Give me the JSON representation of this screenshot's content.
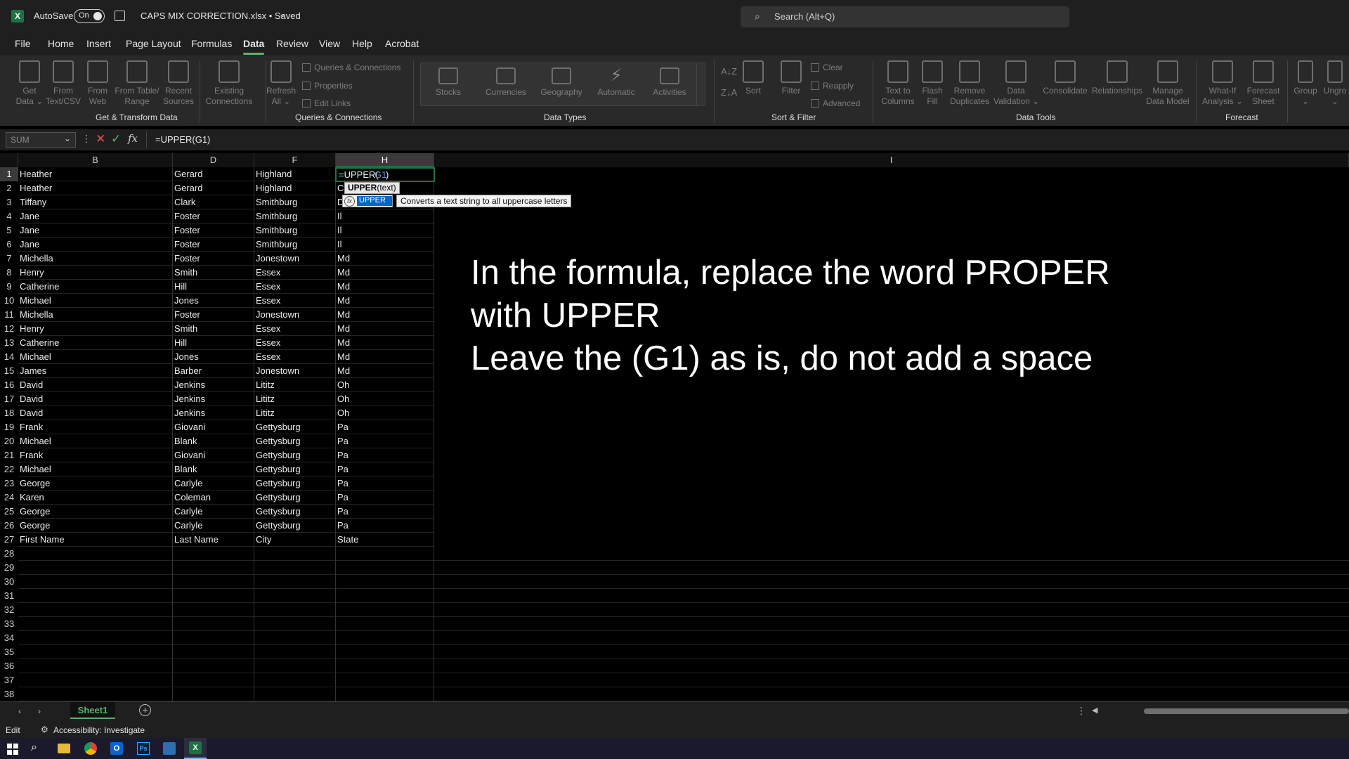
{
  "title": {
    "autosave_label": "AutoSave",
    "autosave_state": "On",
    "filename": "CAPS MIX CORRECTION.xlsx • Saved",
    "search_placeholder": "Search (Alt+Q)"
  },
  "tabs": [
    "File",
    "Home",
    "Insert",
    "Page Layout",
    "Formulas",
    "Data",
    "Review",
    "View",
    "Help",
    "Acrobat"
  ],
  "active_tab": "Data",
  "ribbon": {
    "get_data": "Get\nData ⌄",
    "from_text_csv": "From\nText/CSV",
    "from_web": "From\nWeb",
    "from_table": "From Table/\nRange",
    "recent_sources": "Recent\nSources",
    "existing_connections": "Existing\nConnections",
    "group_get_transform": "Get & Transform Data",
    "refresh_all": "Refresh\nAll ⌄",
    "queries_connections": "Queries & Connections",
    "properties": "Properties",
    "edit_links": "Edit Links",
    "group_queries": "Queries & Connections",
    "stocks": "Stocks",
    "currencies": "Currencies",
    "geography": "Geography",
    "automatic": "Automatic",
    "activities": "Activities",
    "group_data_types": "Data Types",
    "sort": "Sort",
    "filter": "Filter",
    "clear": "Clear",
    "reapply": "Reapply",
    "advanced": "Advanced",
    "group_sort_filter": "Sort & Filter",
    "text_to_columns": "Text to\nColumns",
    "flash_fill": "Flash\nFill",
    "remove_duplicates": "Remove\nDuplicates",
    "data_validation": "Data\nValidation ⌄",
    "consolidate": "Consolidate",
    "relationships": "Relationships",
    "manage_data_model": "Manage\nData Model",
    "group_data_tools": "Data Tools",
    "what_if": "What-If\nAnalysis ⌄",
    "forecast_sheet": "Forecast\nSheet",
    "group_forecast": "Forecast",
    "group": "Group\n⌄",
    "ungroup": "Ungro\n⌄"
  },
  "formula_bar": {
    "name_box": "SUM",
    "formula": "=UPPER(G1)"
  },
  "columns": [
    "B",
    "D",
    "F",
    "H",
    "I"
  ],
  "rows": [
    [
      "Heather",
      "Gerard",
      "Highland",
      ""
    ],
    [
      "Heather",
      "Gerard",
      "Highland",
      "C"
    ],
    [
      "Tiffany",
      "Clark",
      "Smithburg",
      "D"
    ],
    [
      "Jane",
      "Foster",
      "Smithburg",
      "Il"
    ],
    [
      "Jane",
      "Foster",
      "Smithburg",
      "Il"
    ],
    [
      "Jane",
      "Foster",
      "Smithburg",
      "Il"
    ],
    [
      "Michella",
      "Foster",
      "Jonestown",
      "Md"
    ],
    [
      "Henry",
      "Smith",
      "Essex",
      "Md"
    ],
    [
      "Catherine",
      "Hill",
      "Essex",
      "Md"
    ],
    [
      "Michael",
      "Jones",
      "Essex",
      "Md"
    ],
    [
      "Michella",
      "Foster",
      "Jonestown",
      "Md"
    ],
    [
      "Henry",
      "Smith",
      "Essex",
      "Md"
    ],
    [
      "Catherine",
      "Hill",
      "Essex",
      "Md"
    ],
    [
      "Michael",
      "Jones",
      "Essex",
      "Md"
    ],
    [
      "James",
      "Barber",
      "Jonestown",
      "Md"
    ],
    [
      "David",
      "Jenkins",
      "Lititz",
      "Oh"
    ],
    [
      "David",
      "Jenkins",
      "Lititz",
      "Oh"
    ],
    [
      "David",
      "Jenkins",
      "Lititz",
      "Oh"
    ],
    [
      "Frank",
      "Giovani",
      "Gettysburg",
      "Pa"
    ],
    [
      "Michael",
      "Blank",
      "Gettysburg",
      "Pa"
    ],
    [
      "Frank",
      "Giovani",
      "Gettysburg",
      "Pa"
    ],
    [
      "Michael",
      "Blank",
      "Gettysburg",
      "Pa"
    ],
    [
      "George",
      "Carlyle",
      "Gettysburg",
      "Pa"
    ],
    [
      "Karen",
      "Coleman",
      "Gettysburg",
      "Pa"
    ],
    [
      "George",
      "Carlyle",
      "Gettysburg",
      "Pa"
    ],
    [
      "George",
      "Carlyle",
      "Gettysburg",
      "Pa"
    ],
    [
      "First Name",
      "Last Name",
      "City",
      "State"
    ]
  ],
  "row_count": 38,
  "editing_cell": {
    "prefix": "=UPPER(",
    "ref": "G1",
    "suffix": ")"
  },
  "autocomplete": {
    "hint_fn": "UPPER",
    "hint_args": "(text)",
    "item": "UPPER",
    "tooltip": "Converts a text string to all uppercase letters"
  },
  "instruction": {
    "line1": "In the formula, replace the word PROPER",
    "line2": "with UPPER",
    "line3": "Leave the (G1) as is, do not add a space"
  },
  "sheet_tab": "Sheet1",
  "status": {
    "mode": "Edit",
    "accessibility": "Accessibility: Investigate"
  },
  "colors": {
    "accent_green": "#1e7145",
    "selection_blue": "#0a64c8",
    "ref_blue": "#5b9bd5"
  }
}
